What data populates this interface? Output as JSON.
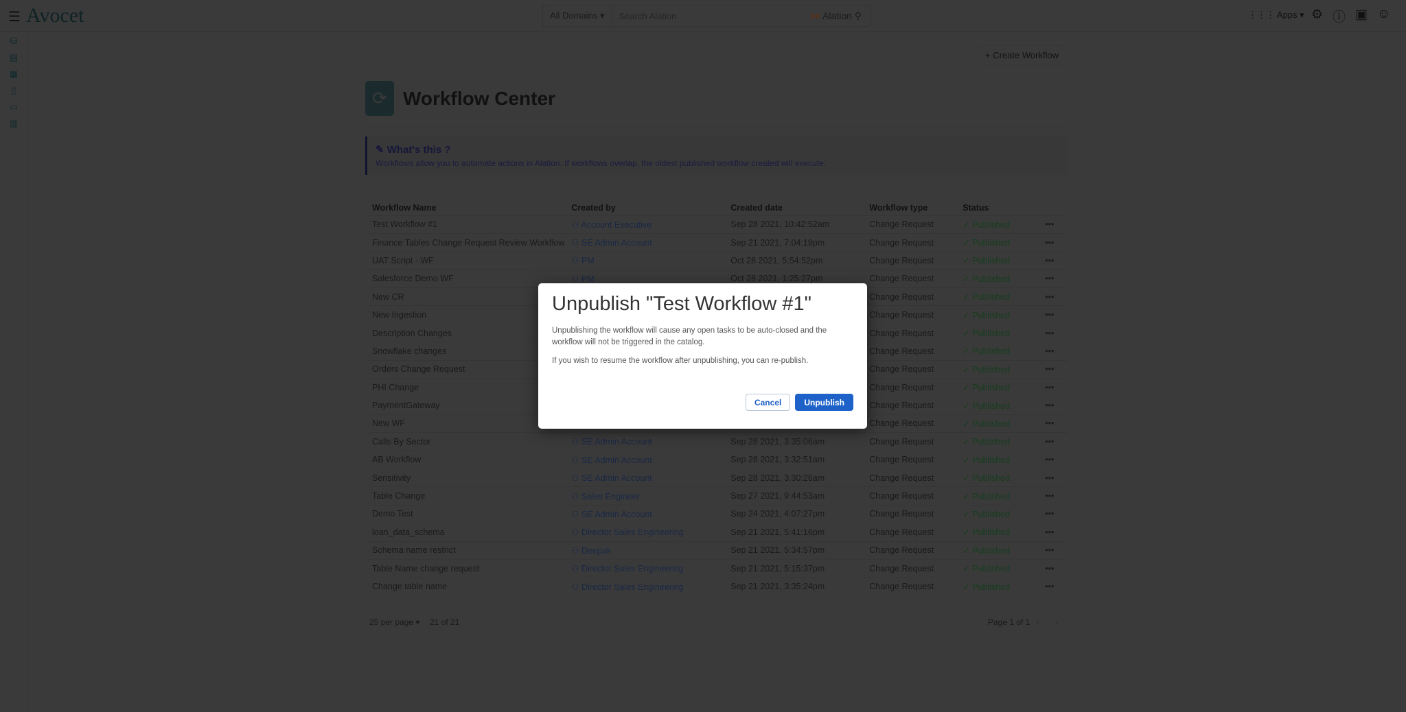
{
  "header": {
    "logo": "Avocet",
    "domains": "All Domains ▾",
    "search_placeholder": "Search Alation",
    "search_brand": "Alation",
    "apps": "Apps ▾"
  },
  "page": {
    "create_button": "+ Create Workflow",
    "title": "Workflow Center",
    "info_title": "What's this ?",
    "info_text": "Workflows allow you to automate actions in Alation. If workflows overlap, the oldest published workflow created will execute."
  },
  "table": {
    "headers": [
      "Workflow Name",
      "Created by",
      "Created date",
      "Workflow type",
      "Status"
    ],
    "rows": [
      {
        "name": "Test Workflow #1",
        "by": "Account Executive",
        "date": "Sep 28 2021, 10:42:52am",
        "type": "Change Request",
        "status": "Published"
      },
      {
        "name": "Finance Tables Change Request Review Workflow",
        "by": "SE Admin Account",
        "date": "Sep 21 2021, 7:04:19pm",
        "type": "Change Request",
        "status": "Published"
      },
      {
        "name": "UAT Script - WF",
        "by": "PM",
        "date": "Oct 28 2021, 5:54:52pm",
        "type": "Change Request",
        "status": "Published"
      },
      {
        "name": "Salesforce Demo WF",
        "by": "PM",
        "date": "Oct 28 2021, 1:25:27pm",
        "type": "Change Request",
        "status": "Published"
      },
      {
        "name": "New CR",
        "by": "",
        "date": "",
        "type": "Change Request",
        "status": "Published"
      },
      {
        "name": "New Ingestion",
        "by": "",
        "date": "",
        "type": "Change Request",
        "status": "Published"
      },
      {
        "name": "Description Changes",
        "by": "",
        "date": "",
        "type": "Change Request",
        "status": "Published"
      },
      {
        "name": "Snowflake changes",
        "by": "",
        "date": "",
        "type": "Change Request",
        "status": "Published"
      },
      {
        "name": "Orders Change Request",
        "by": "",
        "date": "",
        "type": "Change Request",
        "status": "Published"
      },
      {
        "name": "PHI Change",
        "by": "",
        "date": "",
        "type": "Change Request",
        "status": "Published"
      },
      {
        "name": "PaymentGateway",
        "by": "",
        "date": "",
        "type": "Change Request",
        "status": "Published"
      },
      {
        "name": "New WF",
        "by": "",
        "date": "",
        "type": "Change Request",
        "status": "Published"
      },
      {
        "name": "Calls By Sector",
        "by": "SE Admin Account",
        "date": "Sep 28 2021, 3:35:06am",
        "type": "Change Request",
        "status": "Published"
      },
      {
        "name": "AB Workflow",
        "by": "SE Admin Account",
        "date": "Sep 28 2021, 3:32:51am",
        "type": "Change Request",
        "status": "Published"
      },
      {
        "name": "Sensitivity",
        "by": "SE Admin Account",
        "date": "Sep 28 2021, 3:30:26am",
        "type": "Change Request",
        "status": "Published"
      },
      {
        "name": "Table Change",
        "by": "Sales Engineer",
        "date": "Sep 27 2021, 9:44:53am",
        "type": "Change Request",
        "status": "Published"
      },
      {
        "name": "Demo Test",
        "by": "SE Admin Account",
        "date": "Sep 24 2021, 4:07:27pm",
        "type": "Change Request",
        "status": "Published"
      },
      {
        "name": "loan_data_schema",
        "by": "Director Sales Engineering",
        "date": "Sep 21 2021, 5:41:16pm",
        "type": "Change Request",
        "status": "Published"
      },
      {
        "name": "Schema name restrict",
        "by": "Deepak",
        "date": "Sep 21 2021, 5:34:57pm",
        "type": "Change Request",
        "status": "Published"
      },
      {
        "name": "Table Name change request",
        "by": "Director Sales Engineering",
        "date": "Sep 21 2021, 5:15:37pm",
        "type": "Change Request",
        "status": "Published"
      },
      {
        "name": "Change table name",
        "by": "Director Sales Engineering",
        "date": "Sep 21 2021, 3:35:24pm",
        "type": "Change Request",
        "status": "Published"
      }
    ]
  },
  "pagination": {
    "per_page": "25 per page ▾",
    "count": "21 of 21",
    "page": "Page 1 of 1"
  },
  "modal": {
    "title": "Unpublish \"Test Workflow #1\"",
    "text1": "Unpublishing the workflow will cause any open tasks to be auto-closed and the workflow will not be triggered in the catalog.",
    "text2": "If you wish to resume the workflow after unpublishing, you can re-publish.",
    "cancel": "Cancel",
    "confirm": "Unpublish"
  }
}
